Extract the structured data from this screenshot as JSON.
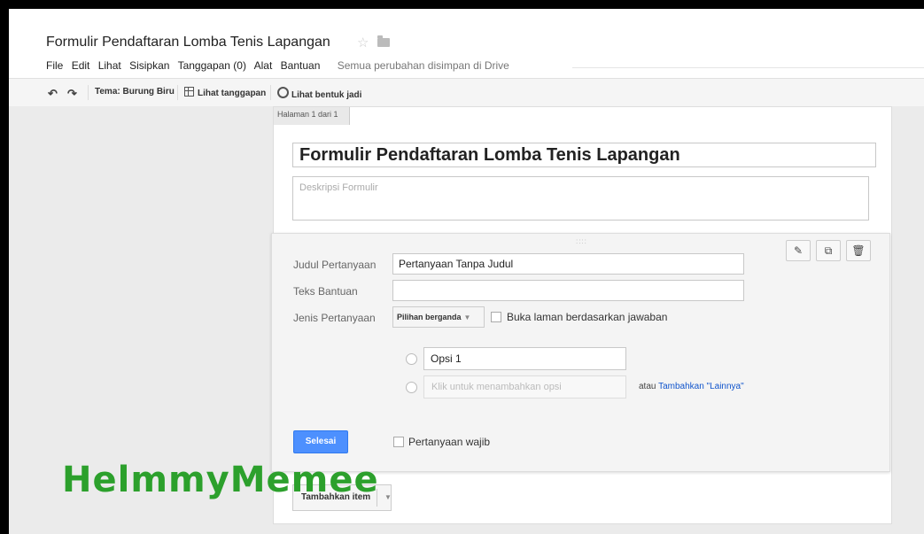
{
  "header": {
    "title": "Formulir Pendaftaran Lomba Tenis Lapangan",
    "menu": [
      "File",
      "Edit",
      "Lihat",
      "Sisipkan",
      "Tanggapan (0)",
      "Alat",
      "Bantuan"
    ],
    "save_status": "Semua perubahan disimpan di Drive"
  },
  "toolbar": {
    "theme": "Tema: Burung Biru",
    "view_responses": "Lihat tanggapan",
    "view_live_form": "Lihat bentuk jadi"
  },
  "page": {
    "tab": "Halaman 1 dari 1",
    "form_title": "Formulir Pendaftaran Lomba Tenis Lapangan",
    "description_placeholder": "Deskripsi Formulir"
  },
  "question": {
    "drag_handle": "::::",
    "title_label": "Judul Pertanyaan",
    "title_value": "Pertanyaan Tanpa Judul",
    "help_label": "Teks Bantuan",
    "help_value": "",
    "type_label": "Jenis Pertanyaan",
    "type_value": "Pilihan berganda",
    "goto_page_label": "Buka laman berdasarkan jawaban",
    "option1": "Opsi 1",
    "add_option_placeholder": "Klik untuk menambahkan opsi",
    "or_text": "atau ",
    "add_other": "Tambahkan \"Lainnya\"",
    "done_label": "Selesai",
    "required_label": "Pertanyaan wajib"
  },
  "add_item": "Tambahkan item",
  "watermark": "HelmmyMemee",
  "icons": {
    "undo": "undo-icon",
    "redo": "redo-icon",
    "edit": "pencil-icon",
    "duplicate": "duplicate-icon",
    "delete": "trash-icon",
    "star": "star-icon",
    "folder": "folder-icon"
  },
  "colors": {
    "primary_button": "#4d90fe",
    "link": "#1155cc",
    "watermark": "#2ca02c"
  }
}
